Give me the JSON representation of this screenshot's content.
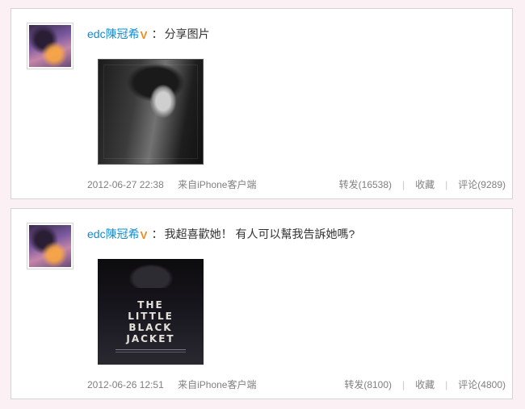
{
  "posts": [
    {
      "username": "edc陳冠希",
      "verified_icon": "vip-v-icon",
      "colon": "：",
      "text": "分享图片",
      "time": "2012-06-27 22:38",
      "source": "来自iPhone客户端",
      "repost_label": "转发(16538)",
      "favorite_label": "收藏",
      "comment_label": "评论(9289)"
    },
    {
      "username": "edc陳冠希",
      "verified_icon": "vip-v-icon",
      "colon": "：",
      "text": "我超喜歡她！ 有人可以幫我告訴她嗎?",
      "time": "2012-06-26 12:51",
      "source": "来自iPhone客户端",
      "repost_label": "转发(8100)",
      "favorite_label": "收藏",
      "comment_label": "评论(4800)",
      "poster_text": "THE\nLITTLE\nBLACK\nJACKET"
    }
  ],
  "separator": "|",
  "colors": {
    "page_bg": "#fbf0f3",
    "username": "#0a8cd2",
    "vip": "#f08a18",
    "meta": "#808080"
  }
}
